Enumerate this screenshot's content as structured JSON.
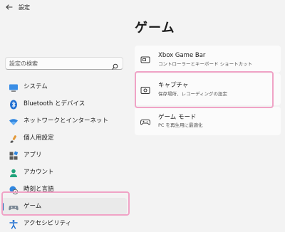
{
  "window": {
    "title": "設定"
  },
  "search": {
    "placeholder": "設定の検索"
  },
  "page": {
    "title": "ゲーム"
  },
  "sidebar": {
    "items": [
      {
        "label": "システム",
        "icon": "monitor-icon"
      },
      {
        "label": "Bluetooth とデバイス",
        "icon": "bluetooth-icon"
      },
      {
        "label": "ネットワークとインターネット",
        "icon": "wifi-icon"
      },
      {
        "label": "個人用設定",
        "icon": "brush-icon"
      },
      {
        "label": "アプリ",
        "icon": "apps-icon"
      },
      {
        "label": "アカウント",
        "icon": "person-icon"
      },
      {
        "label": "時刻と言語",
        "icon": "globe-clock-icon"
      },
      {
        "label": "ゲーム",
        "icon": "gamepad-icon",
        "selected": true
      },
      {
        "label": "アクセシビリティ",
        "icon": "accessibility-icon"
      }
    ]
  },
  "cards": [
    {
      "title": "Xbox Game Bar",
      "subtitle": "コントローラーとキーボード ショートカット",
      "icon": "xbox-bar-icon"
    },
    {
      "title": "キャプチャ",
      "subtitle": "保存場所、レコーディングの設定",
      "icon": "capture-icon"
    },
    {
      "title": "ゲーム モード",
      "subtitle": "PC を再生用に最適化",
      "icon": "game-mode-icon"
    }
  ],
  "colors": {
    "accent": "#1a5fb4",
    "highlight": "#f0a3c6",
    "background": "#f3f3f3",
    "card": "#fbfbfb"
  }
}
